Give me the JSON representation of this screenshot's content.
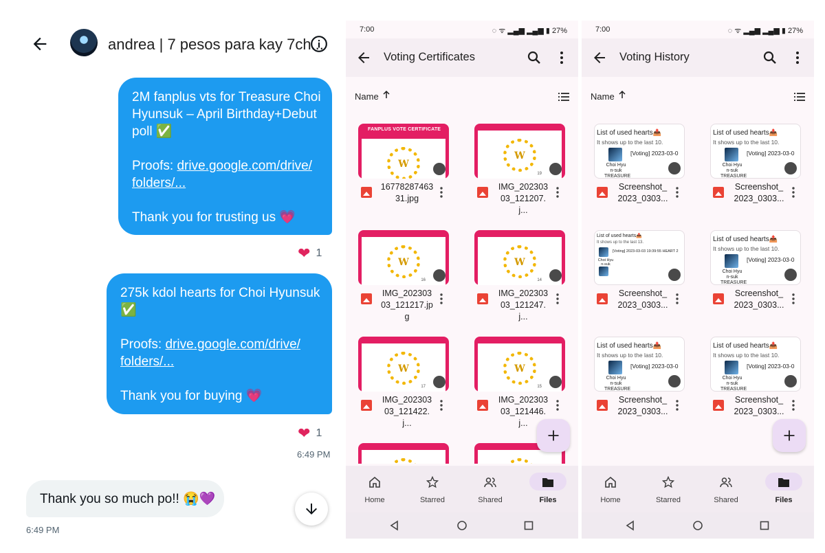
{
  "chat": {
    "header": {
      "title": "andrea | 7 pesos para kay 7ch..."
    },
    "message1": {
      "line1": "2M fanplus vts for Treasure Choi",
      "line2": "Hyunsuk – April Birthday+Debut",
      "line3": "poll ✅",
      "proofs_label": "Proofs: ",
      "link_part1": "drive.google.com/drive/",
      "link_part2": "folders/...",
      "closing": "Thank you for trusting us 💗",
      "reaction_count": "1"
    },
    "message2": {
      "line1": "275k kdol hearts for Choi Hyunsuk",
      "line2": "✅",
      "proofs_label": "Proofs: ",
      "link_part1": "drive.google.com/drive/",
      "link_part2": "folders/...",
      "closing": "Thank you for buying 💗",
      "reaction_count": "1",
      "time": "6:49 PM"
    },
    "reply": {
      "text": "Thank you so much po!! 😭💜",
      "time": "6:49 PM"
    }
  },
  "status_bar": {
    "time": "7:00",
    "battery": "27%"
  },
  "screen1": {
    "title": "Voting Certificates",
    "sort_label": "Name",
    "files": [
      {
        "name": "16778287463 31.jpg",
        "thumb_header": "FANPLUS VOTE CERTIFICATE",
        "thumb_number": ""
      },
      {
        "name": "IMG_202303 03_121207.j...",
        "thumb_header": "",
        "thumb_number": "19"
      },
      {
        "name": "IMG_202303 03_121217.jpg",
        "thumb_header": "",
        "thumb_number": "16"
      },
      {
        "name": "IMG_202303 03_121247.j...",
        "thumb_header": "",
        "thumb_number": "14"
      },
      {
        "name": "IMG_202303 03_121422.j...",
        "thumb_header": "",
        "thumb_number": "17"
      },
      {
        "name": "IMG_202303 03_121446.j...",
        "thumb_header": "",
        "thumb_number": "15"
      }
    ]
  },
  "screen2": {
    "title": "Voting History",
    "sort_label": "Name",
    "files": [
      {
        "name": "Screenshot_ 2023_0303...",
        "thumb_title": "List of used hearts📤",
        "thumb_sub": "It shows up to the last 10.",
        "thumb_entry": "[Voting] 2023-03-0",
        "thumb_caption": "Choi Hyu n-suk TREASURE"
      },
      {
        "name": "Screenshot_ 2023_0303...",
        "thumb_title": "List of used hearts📤",
        "thumb_sub": "It shows up to the last 10.",
        "thumb_entry": "[Voting] 2023-03-0",
        "thumb_caption": "Choi Hyu n-suk TREASURE"
      },
      {
        "name": "Screenshot_ 2023_0303...",
        "thumb_title": "List of used hearts📤",
        "thumb_sub": "It shows up to the last 13.",
        "thumb_entry": "[Voting] 2023-03-03 19:39:55 HEART 2",
        "thumb_caption": "Choi Hyu n-suk"
      },
      {
        "name": "Screenshot_ 2023_0303...",
        "thumb_title": "List of used hearts📤",
        "thumb_sub": "It shows up to the last 10.",
        "thumb_entry": "[Voting] 2023-03-0",
        "thumb_caption": "Choi Hyu n-suk TREASURE"
      },
      {
        "name": "Screenshot_ 2023_0303...",
        "thumb_title": "List of used hearts📤",
        "thumb_sub": "It shows up to the last 10.",
        "thumb_entry": "[Voting] 2023-03-0",
        "thumb_caption": "Choi Hyu n-suk TREASURE"
      },
      {
        "name": "Screenshot_ 2023_0303...",
        "thumb_title": "List of used hearts📤",
        "thumb_sub": "It shows up to the last 10.",
        "thumb_entry": "[Voting] 2023-03-0",
        "thumb_caption": "Choi Hyu n-suk TREASURE"
      }
    ]
  },
  "bottom_nav": {
    "home": "Home",
    "starred": "Starred",
    "shared": "Shared",
    "files": "Files",
    "active": "Files"
  },
  "colors": {
    "tweet_blue": "#1d9bf0",
    "heart_red": "#e0245e",
    "cert_pink": "#e31e63",
    "fab_bg": "#ecdcf5"
  },
  "icons": [
    "back-arrow-icon",
    "info-icon",
    "heart-icon",
    "arrow-down-icon",
    "search-icon",
    "more-vert-icon",
    "sort-up-icon",
    "list-view-icon",
    "image-file-icon",
    "shared-people-icon",
    "plus-icon",
    "home-icon",
    "star-icon",
    "people-icon",
    "folder-icon",
    "nav-back-icon",
    "nav-home-icon",
    "nav-recents-icon"
  ]
}
